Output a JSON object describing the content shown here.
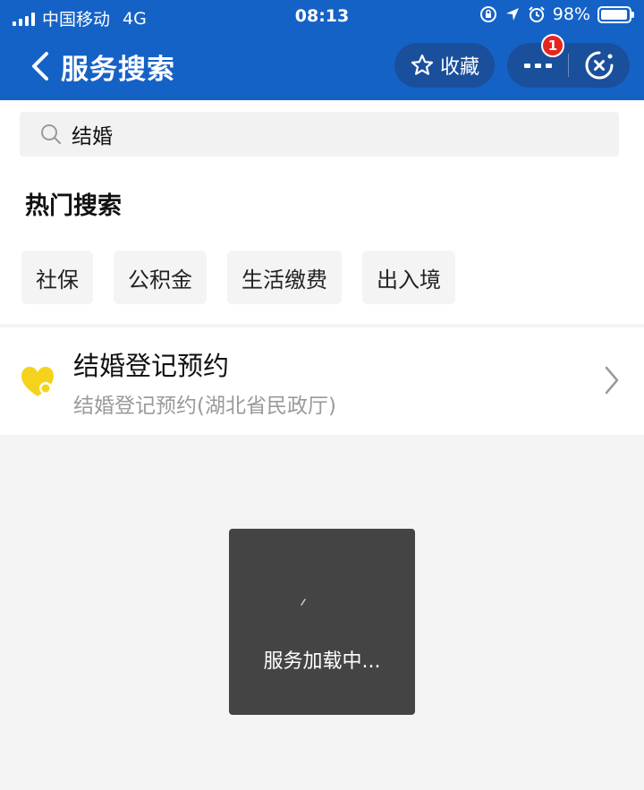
{
  "status_bar": {
    "carrier": "中国移动",
    "network": "4G",
    "time": "08:13",
    "battery": "98%",
    "battery_level": 0.98
  },
  "header": {
    "title": "服务搜索",
    "favorite_label": "收藏",
    "notification_count": "1",
    "background_color": "#1562c7"
  },
  "search": {
    "value": "结婚",
    "placeholder": ""
  },
  "hot_search": {
    "title": "热门搜索",
    "tags": [
      "社保",
      "公积金",
      "生活缴费",
      "出入境"
    ]
  },
  "results": [
    {
      "title": "结婚登记预约",
      "subtitle": "结婚登记预约(湖北省民政厅)",
      "icon": "heart-icon",
      "icon_color": "#f5d31c"
    }
  ],
  "toast": {
    "message": "服务加载中..."
  }
}
